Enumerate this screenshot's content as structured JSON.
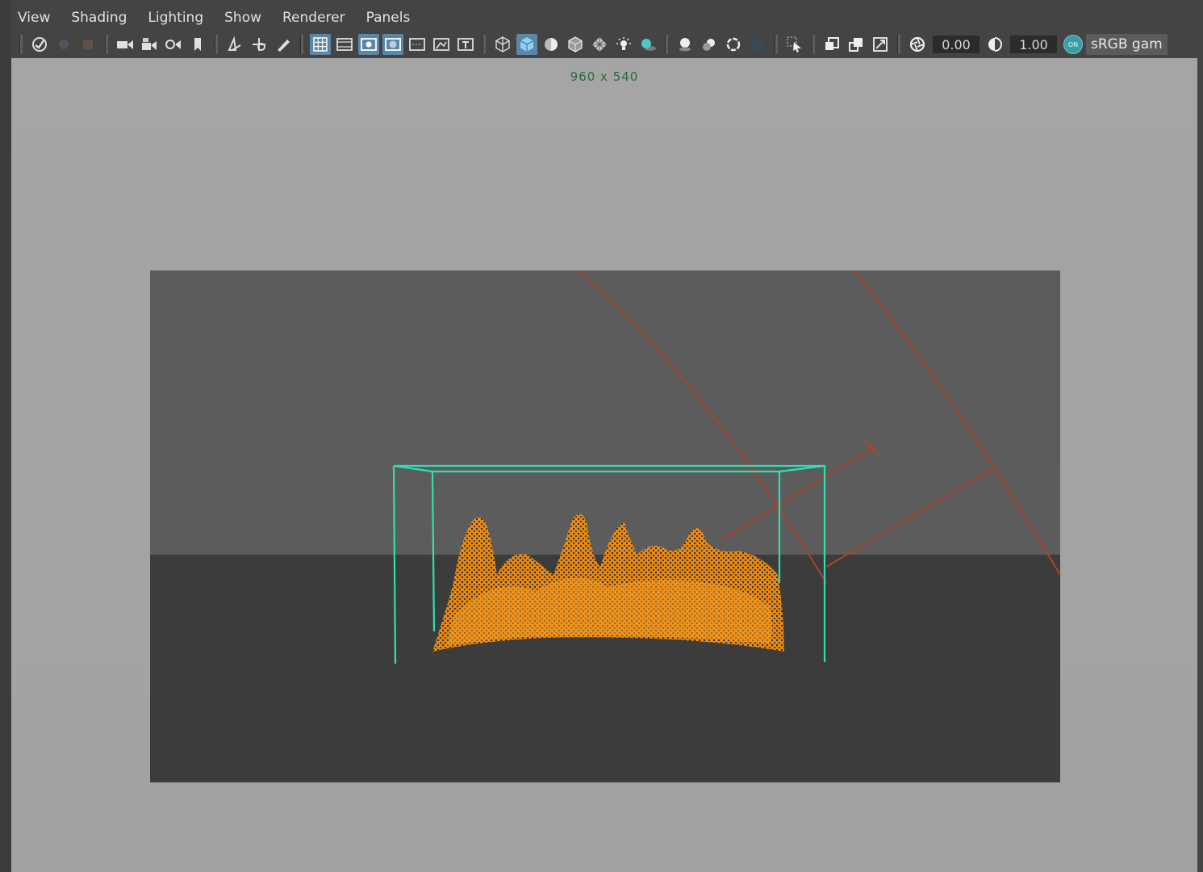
{
  "menu": {
    "items": [
      {
        "label": "View"
      },
      {
        "label": "Shading"
      },
      {
        "label": "Lighting"
      },
      {
        "label": "Show"
      },
      {
        "label": "Renderer"
      },
      {
        "label": "Panels"
      }
    ]
  },
  "toolbar": {
    "exposure_value": "0.00",
    "gamma_value": "1.00",
    "color_management_badge": "ON",
    "color_space_label": "sRGB gam",
    "icons": [
      "select-camera-icon",
      "camera-attributes-icon",
      "bookmark-icon",
      "image-plane-icon",
      "2d-pan-zoom-icon",
      "grease-pencil-icon",
      "grid-icon",
      "film-gate-icon",
      "resolution-gate-icon",
      "gate-mask-icon",
      "field-chart-icon",
      "safe-action-icon",
      "safe-title-icon",
      "wireframe-icon",
      "smooth-shade-icon",
      "default-material-icon",
      "shaded-wireframe-icon",
      "textured-icon",
      "use-lights-icon",
      "shadows-icon",
      "screen-space-ao-icon",
      "motion-blur-icon",
      "antialiasing-icon",
      "depth-of-field-icon",
      "isolate-select-icon",
      "xray-icon",
      "xray-active-icon",
      "xray-joints-icon",
      "exposure-icon",
      "gamma-icon"
    ],
    "accent_color": "#5a87a8"
  },
  "viewport": {
    "resolution_label": "960 x 540",
    "background_color": "#a3a3a3",
    "gate_top_color": "#5c5c5c",
    "gate_bottom_color": "#3c3c3c",
    "fluid_container_color": "#2ee0b0",
    "light_color": "#b0452c",
    "fire_color": "#f0901a"
  }
}
